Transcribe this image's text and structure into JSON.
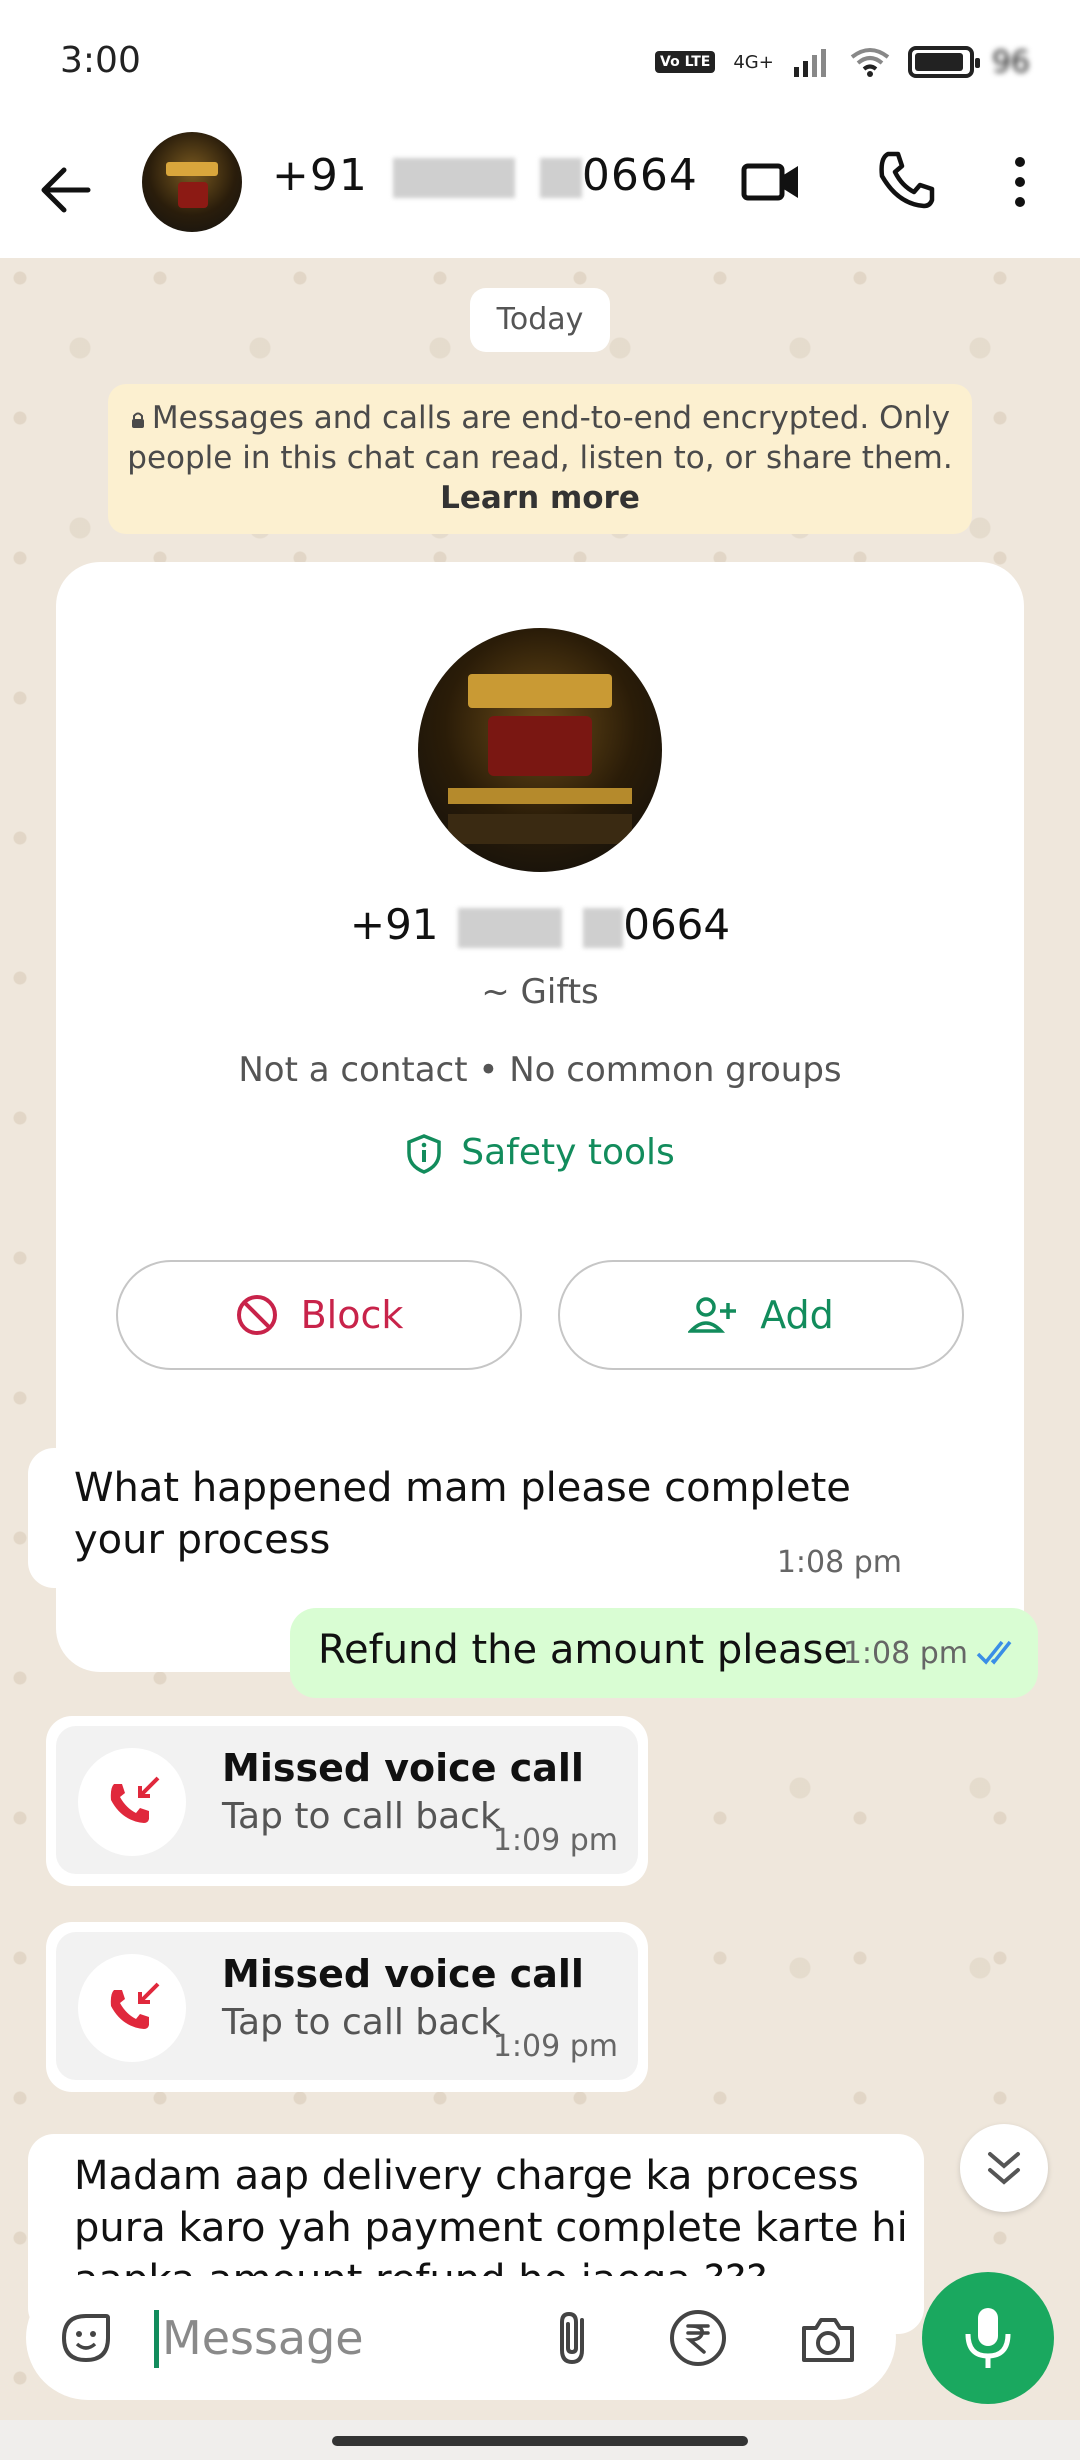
{
  "status_bar": {
    "time": "3:00",
    "volte_label": "Vo LTE",
    "network_label": "4G+",
    "battery_percent_text": "96"
  },
  "header": {
    "contact_prefix": "+91",
    "contact_suffix": "0664",
    "icons": [
      "back-arrow-icon",
      "video-call-icon",
      "voice-call-icon",
      "more-vert-icon"
    ]
  },
  "chat": {
    "date_chip": "Today",
    "encryption_notice": "Messages and calls are end-to-end encrypted. Only people in this chat can read, listen to, or share them.",
    "learn_more": "Learn more",
    "profile_card": {
      "phone_prefix": "+91",
      "phone_suffix": "0664",
      "about": "~ Gifts",
      "meta": "Not a contact • No common groups",
      "safety_tools": "Safety tools",
      "block_label": "Block",
      "add_label": "Add"
    },
    "messages": [
      {
        "direction": "in",
        "text": "What happened mam please complete your process",
        "time": "1:08 pm"
      },
      {
        "direction": "out",
        "text": "Refund the amount please",
        "time": "1:08 pm",
        "status": "read"
      },
      {
        "direction": "in",
        "type": "missed_call",
        "title": "Missed voice call",
        "subtitle": "Tap to call back",
        "time": "1:09 pm"
      },
      {
        "direction": "in",
        "type": "missed_call",
        "title": "Missed voice call",
        "subtitle": "Tap to call back",
        "time": "1:09 pm"
      },
      {
        "direction": "in",
        "text": "Madam aap delivery charge ka process pura karo yah payment complete karte hi aapka amount refund ho jaega ???"
      }
    ]
  },
  "composer": {
    "placeholder": "Message"
  },
  "colors": {
    "accent_green": "#128c5c",
    "outgoing_bubble": "#d9fdd3",
    "block_red": "#c8234a",
    "chat_bg": "#efe7dc",
    "notice_bg": "#fcf0d0",
    "mic_button": "#1aa85f"
  }
}
